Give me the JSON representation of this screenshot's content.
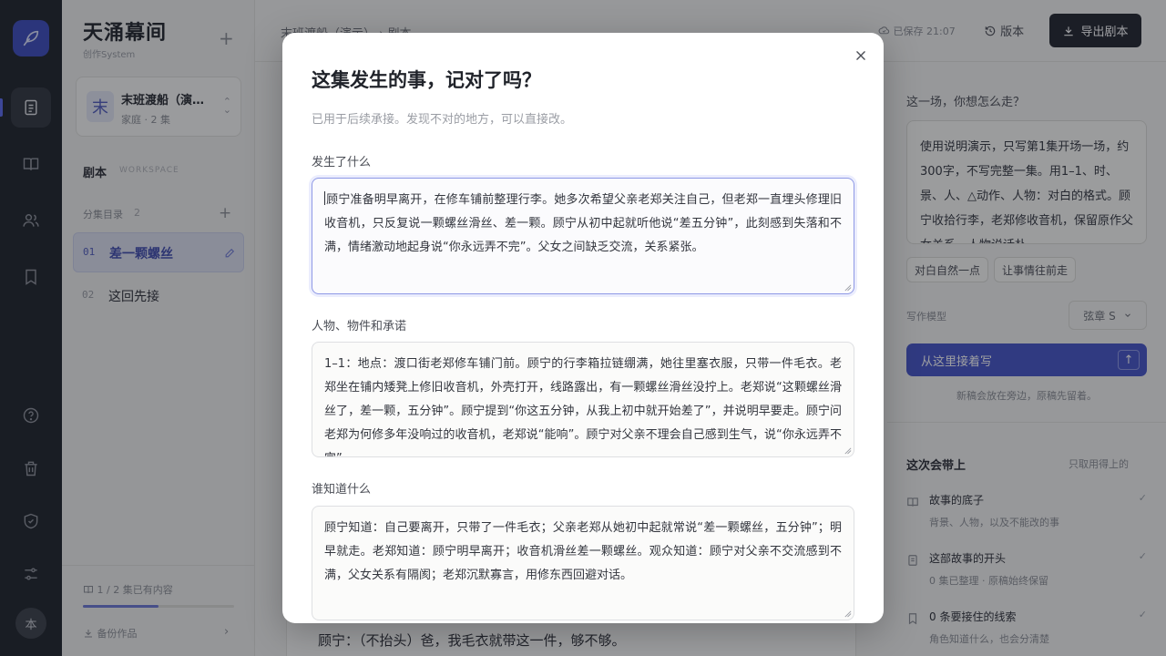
{
  "app": {
    "name": "天涌幕间",
    "subtitle": "创作System"
  },
  "project": {
    "avatar_char": "末",
    "name": "末班渡船（演…",
    "meta": "家庭 · 2 集"
  },
  "sidebar": {
    "section_title": "剧本",
    "section_sub": "WORKSPACE",
    "episodes_label": "分集目录",
    "episodes_count": "2",
    "episodes": [
      {
        "num": "01",
        "title": "差一颗螺丝"
      },
      {
        "num": "02",
        "title": "这回先接"
      }
    ],
    "progress_text": "1 / 2 集已有内容",
    "progress_fraction": 0.5,
    "backup_label": "备份作品"
  },
  "header": {
    "breadcrumb": "末班渡船（演示）  ›  剧本",
    "saved": "已保存 21:07",
    "version": "版本",
    "export": "导出剧本"
  },
  "editor": {
    "visible_line": "顾宁：（不抬头）爸，我毛衣就带这一件，够不够。"
  },
  "panel": {
    "question": "这一场，你想怎么走？",
    "prompt_text": "使用说明演示，只写第1集开场一场，约300字，不写完整一集。用1–1、时、景、人、△动作、人物：对白的格式。顾宁收拾行李，老郑修收音机，保留原作父女关系，人物说话朴",
    "chips": [
      "对白自然一点",
      "让事情往前走"
    ],
    "model_label": "写作模型",
    "model_value": "弦章 S",
    "continue_button": "从这里接着写",
    "continue_note": "新稿会放在旁边，原稿先留着。",
    "carry_title": "这次会带上",
    "carry_sub": "只取用得上的",
    "carry_items": [
      {
        "title": "故事的底子",
        "desc": "背景、人物，以及不能改的事"
      },
      {
        "title": "这部故事的开头",
        "desc": "0 集已整理 · 原稿始终保留"
      },
      {
        "title": "0 条要接住的线索",
        "desc": "角色知道什么，也会分清楚"
      }
    ]
  },
  "modal": {
    "title": "这集发生的事，记对了吗？",
    "subtitle": "已用于后续承接。发现不对的地方，可以直接改。",
    "fields": [
      {
        "label": "发生了什么",
        "value": "顾宁准备明早离开，在修车铺前整理行李。她多次希望父亲老郑关注自己，但老郑一直埋头修理旧收音机，只反复说一颗螺丝滑丝、差一颗。顾宁从初中起就听他说“差五分钟”，此刻感到失落和不满，情绪激动地起身说“你永远弄不完”。父女之间缺乏交流，关系紧张。"
      },
      {
        "label": "人物、物件和承诺",
        "value": "1–1：地点：渡口街老郑修车铺门前。顾宁的行李箱拉链绷满，她往里塞衣服，只带一件毛衣。老郑坐在铺内矮凳上修旧收音机，外壳打开，线路露出，有一颗螺丝滑丝没拧上。老郑说“这颗螺丝滑丝了，差一颗，五分钟”。顾宁提到“你这五分钟，从我上初中就开始差了”，并说明早要走。顾宁问老郑为何修多年没响过的收音机，老郑说“能响”。顾宁对父亲不理会自己感到生气，说“你永远弄不完”"
      },
      {
        "label": "谁知道什么",
        "value": "顾宁知道：自己要离开，只带了一件毛衣；父亲老郑从她初中起就常说“差一颗螺丝，五分钟”；明早就走。老郑知道：顾宁明早离开；收音机滑丝差一颗螺丝。观众知道：顾宁对父亲不交流感到不满，父女关系有隔阂；老郑沉默寡言，用修东西回避对话。"
      }
    ]
  },
  "colors": {
    "accent": "#4453c9",
    "rail": "#1d2129",
    "export_button": "#1f232b"
  }
}
